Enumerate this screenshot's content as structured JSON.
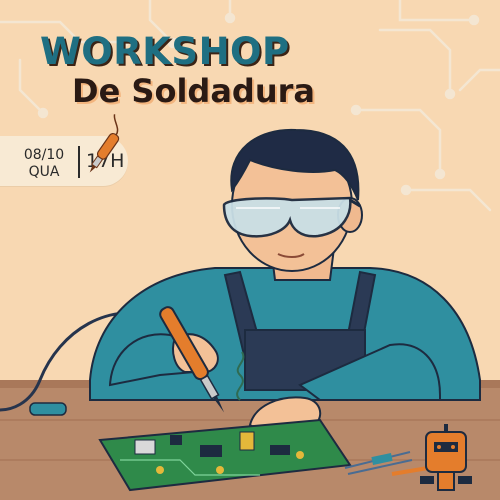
{
  "poster": {
    "title_line1": "WORKSHOP",
    "title_line2": "De Soldadura",
    "date": "08/10",
    "weekday": "QUA",
    "time": "17H"
  },
  "colors": {
    "background": "#f8d8b2",
    "title_teal": "#1f6f82",
    "title_dark": "#2a1a14",
    "badge_bg": "#f8ead4",
    "accent_orange": "#e47d2c",
    "shirt_teal": "#2f8fa0",
    "apron_navy": "#2b3a55",
    "pcb_green": "#2f8a4a",
    "table_wood": "#b88a6a"
  },
  "icons": [
    "soldering-iron-icon",
    "robot-logo-icon"
  ]
}
